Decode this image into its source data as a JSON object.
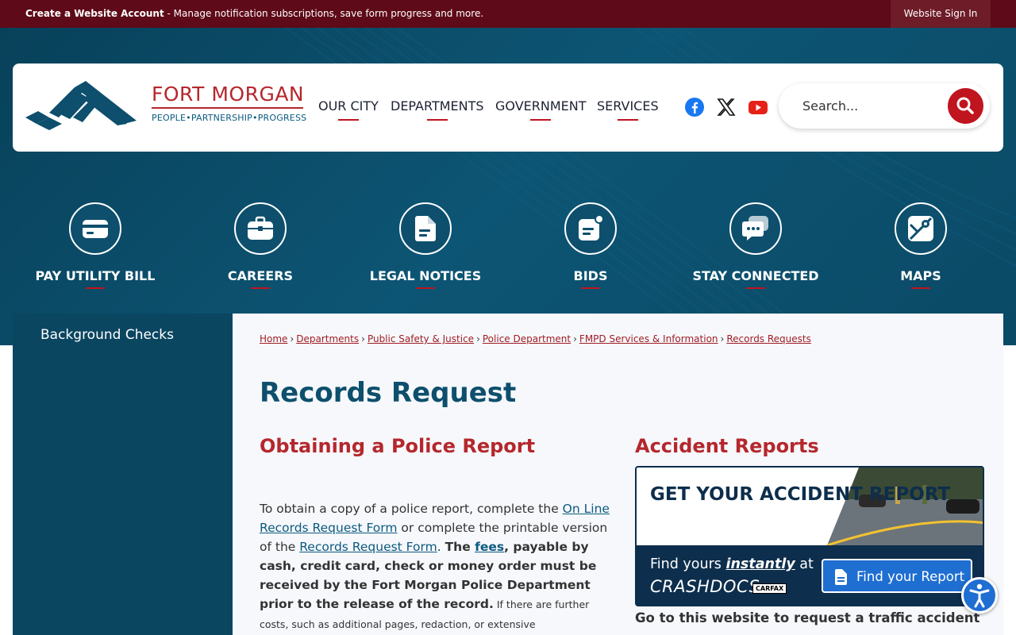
{
  "topbar": {
    "create_label": "Create a Website Account",
    "create_desc": " - Manage notification subscriptions, save form progress and more.",
    "signin": "Website Sign In"
  },
  "brand": {
    "name": "FORT MORGAN",
    "tagline": "PEOPLE•PARTNERSHIP•PROGRESS",
    "accent": "#b5272d",
    "primary": "#0d4f6d"
  },
  "nav": [
    "OUR CITY",
    "DEPARTMENTS",
    "GOVERNMENT",
    "SERVICES"
  ],
  "social": [
    "facebook-icon",
    "x-icon",
    "youtube-icon"
  ],
  "search": {
    "placeholder": "Search..."
  },
  "quick_links": [
    {
      "label": "PAY UTILITY BILL",
      "icon": "credit-card-icon"
    },
    {
      "label": "CAREERS",
      "icon": "briefcase-icon"
    },
    {
      "label": "LEGAL NOTICES",
      "icon": "document-icon"
    },
    {
      "label": "BIDS",
      "icon": "bid-document-icon"
    },
    {
      "label": "STAY CONNECTED",
      "icon": "chat-bubbles-icon"
    },
    {
      "label": "MAPS",
      "icon": "map-icon"
    }
  ],
  "sidebar": {
    "items": [
      "Background Checks"
    ]
  },
  "breadcrumb": [
    "Home",
    "Departments",
    "Public Safety & Justice",
    "Police Department",
    "FMPD Services & Information",
    "Records Requests"
  ],
  "page_title": "Records Request",
  "left_section": {
    "heading": "Obtaining a Police Report",
    "p1": "To obtain a copy of a police report, complete the ",
    "link1": "On Line Records Request Form",
    "p2": " or complete the printable version of the ",
    "link2": "Records Request Form",
    "p3": ".   ",
    "bold1": "The ",
    "link3": "fees",
    "bold2": ", payable by cash, credit card, check or money order must be received by the Fort Morgan Police Department prior to the release of the record.",
    "small": " If there are further costs, such as additional pages, redaction, or extensive"
  },
  "right_section": {
    "heading": "Accident Reports",
    "banner_title": "GET YOUR ACCIDENT REPORT",
    "find_prefix": "Find yours ",
    "find_em": "instantly",
    "find_suffix": " at",
    "crashdocs": "CRASHDOCS",
    "carfax": "CARFAX",
    "button": "Find your Report",
    "go_text": "Go to this website to request a traffic accident"
  }
}
